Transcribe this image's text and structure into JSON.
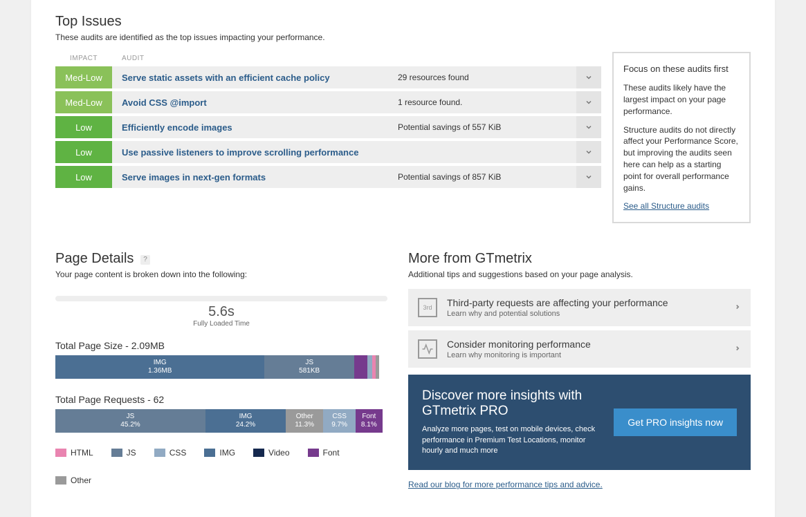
{
  "topIssues": {
    "title": "Top Issues",
    "subtitle": "These audits are identified as the top issues impacting your performance.",
    "headers": {
      "impact": "IMPACT",
      "audit": "AUDIT"
    },
    "rows": [
      {
        "impact": "Med-Low",
        "impactClass": "impact-medlow",
        "audit": "Serve static assets with an efficient cache policy",
        "detail": "29 resources found"
      },
      {
        "impact": "Med-Low",
        "impactClass": "impact-medlow",
        "audit": "Avoid CSS @import",
        "detail": "1 resource found."
      },
      {
        "impact": "Low",
        "impactClass": "impact-low",
        "audit": "Efficiently encode images",
        "detail": "Potential savings of 557 KiB"
      },
      {
        "impact": "Low",
        "impactClass": "impact-low",
        "audit": "Use passive listeners to improve scrolling performance",
        "detail": ""
      },
      {
        "impact": "Low",
        "impactClass": "impact-low",
        "audit": "Serve images in next-gen formats",
        "detail": "Potential savings of 857 KiB"
      }
    ]
  },
  "focusBox": {
    "title": "Focus on these audits first",
    "p1": "These audits likely have the largest impact on your page performance.",
    "p2": "Structure audits do not directly affect your Performance Score, but improving the audits seen here can help as a starting point for overall performance gains.",
    "link": "See all Structure audits"
  },
  "pageDetails": {
    "title": "Page Details",
    "subtitle": "Your page content is broken down into the following:",
    "fullLoad": "5.6s",
    "fullLoadLabel": "Fully Loaded Time",
    "sizeTitle": "Total Page Size - 2.09MB",
    "requestsTitle": "Total Page Requests - 62"
  },
  "chart_data": [
    {
      "type": "bar",
      "title": "Total Page Size",
      "total": "2.09MB",
      "segments": [
        {
          "label": "IMG",
          "sub": "1.36MB",
          "pct": 63.0,
          "color": "c-img"
        },
        {
          "label": "JS",
          "sub": "581KB",
          "pct": 27.0,
          "color": "c-js"
        },
        {
          "label": "",
          "sub": "",
          "pct": 4.0,
          "color": "c-font"
        },
        {
          "label": "",
          "sub": "",
          "pct": 1.5,
          "color": "c-css"
        },
        {
          "label": "",
          "sub": "",
          "pct": 1.0,
          "color": "c-html"
        },
        {
          "label": "",
          "sub": "",
          "pct": 1.0,
          "color": "c-other"
        }
      ]
    },
    {
      "type": "bar",
      "title": "Total Page Requests",
      "total": 62,
      "segments": [
        {
          "label": "JS",
          "sub": "45.2%",
          "pct": 45.2,
          "color": "c-js"
        },
        {
          "label": "IMG",
          "sub": "24.2%",
          "pct": 24.2,
          "color": "c-img"
        },
        {
          "label": "Other",
          "sub": "11.3%",
          "pct": 11.3,
          "color": "c-other"
        },
        {
          "label": "CSS",
          "sub": "9.7%",
          "pct": 9.7,
          "color": "c-css"
        },
        {
          "label": "Font",
          "sub": "8.1%",
          "pct": 8.1,
          "color": "c-font"
        }
      ]
    }
  ],
  "legend": [
    {
      "label": "HTML",
      "class": "c-html"
    },
    {
      "label": "JS",
      "class": "c-js"
    },
    {
      "label": "CSS",
      "class": "c-css"
    },
    {
      "label": "IMG",
      "class": "c-img"
    },
    {
      "label": "Video",
      "class": "c-video"
    },
    {
      "label": "Font",
      "class": "c-font"
    },
    {
      "label": "Other",
      "class": "c-other"
    }
  ],
  "more": {
    "title": "More from GTmetrix",
    "subtitle": "Additional tips and suggestions based on your page analysis.",
    "items": [
      {
        "icon": "3rd",
        "title": "Third-party requests are affecting your performance",
        "sub": "Learn why and potential solutions"
      },
      {
        "icon": "pulse",
        "title": "Consider monitoring performance",
        "sub": "Learn why monitoring is important"
      }
    ]
  },
  "pro": {
    "title": "Discover more insights with GTmetrix PRO",
    "text": "Analyze more pages, test on mobile devices, check performance in Premium Test Locations, monitor hourly and much more",
    "button": "Get PRO insights now"
  },
  "blogLink": "Read our blog for more performance tips and advice."
}
